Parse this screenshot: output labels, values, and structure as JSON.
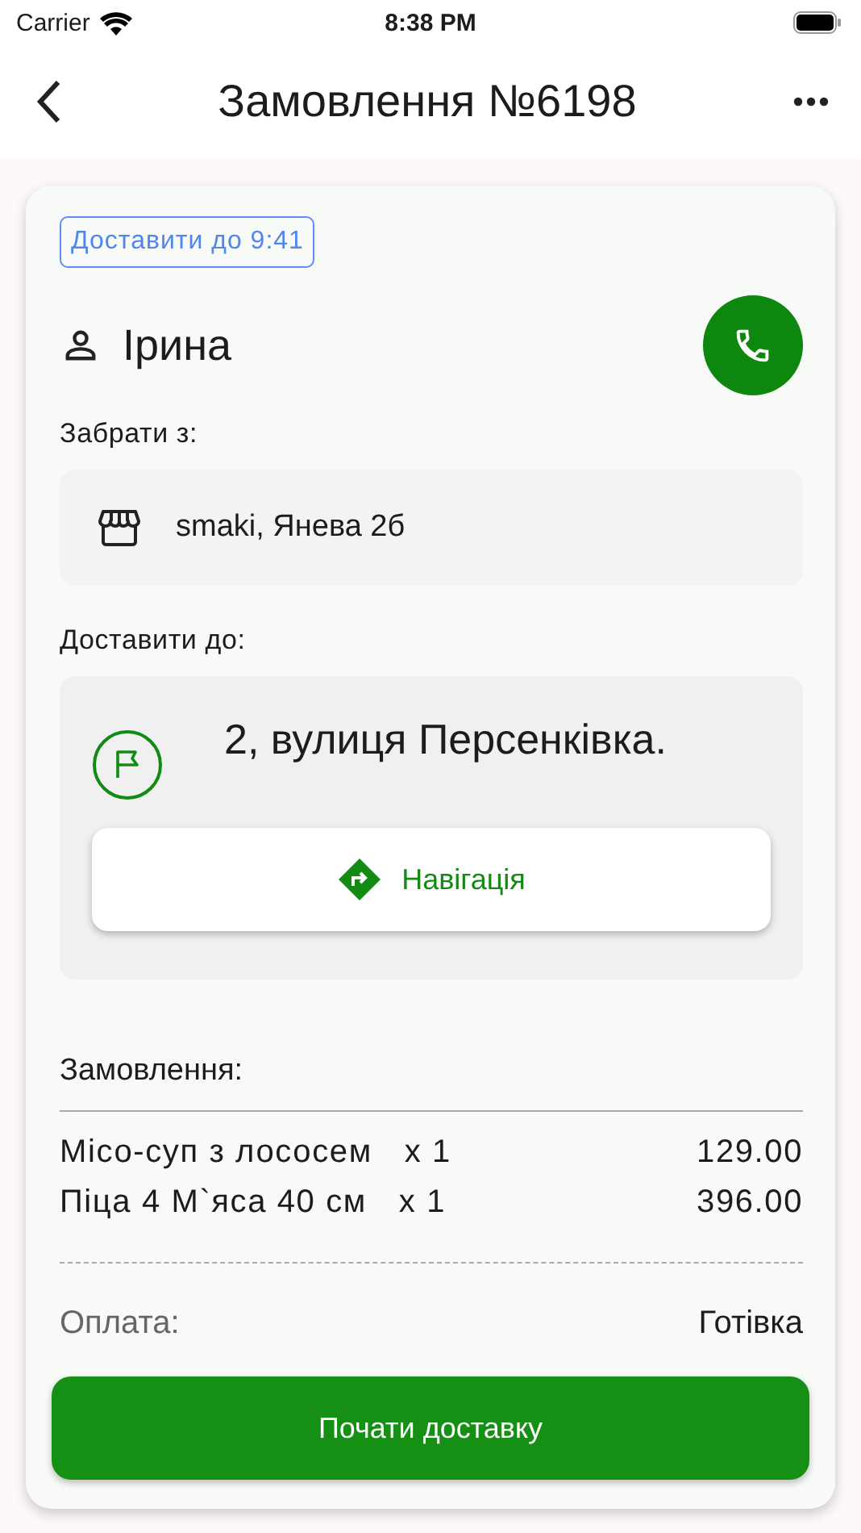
{
  "status_bar": {
    "carrier": "Carrier",
    "time": "8:38 PM"
  },
  "header": {
    "title": "Замовлення №6198"
  },
  "order": {
    "deadline_badge": "Доставити до 9:41",
    "customer": {
      "name": "Ірина"
    },
    "pickup": {
      "label": "Забрати з:",
      "address": "smaki, Янева 2б"
    },
    "delivery": {
      "label": "Доставити до:",
      "address": "2, вулиця Персенківка.",
      "navigation_button": "Навігація"
    },
    "items_title": "Замовлення:",
    "items": [
      {
        "name": "Місо-суп з лососем",
        "quantity": "x 1",
        "price": "129.00"
      },
      {
        "name": "Піца 4 М`яса 40 см",
        "quantity": "x 1",
        "price": "396.00"
      }
    ],
    "payment": {
      "label": "Оплата:",
      "method": "Готівка"
    },
    "start_button": "Почати доставку"
  }
}
